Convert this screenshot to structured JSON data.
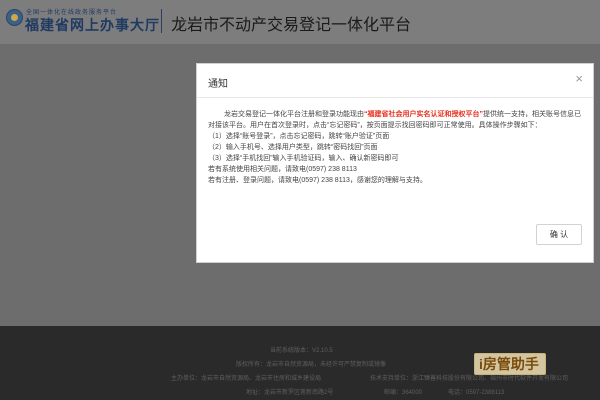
{
  "header": {
    "org_small": "全国一体化在线政务服务平台",
    "org_big": "福建省网上办事大厅",
    "site_title": "龙岩市不动产交易登记一体化平台"
  },
  "modal": {
    "title": "通知",
    "close": "×",
    "intro_before": "龙岩交易登记一体化平台注册和登录功能现由",
    "intro_highlight": "“福建省社会用户实名认证和授权平台”",
    "intro_after": "提供统一支持，相关账号信息已对接该平台。用户在首次登录时，点击“忘记密码”，按页面提示找回密码即可正常使用。具体操作步骤如下：",
    "steps": [
      "（1）选择“账号登录”，点击忘记密码，跳转“账户验证”页面",
      "（2）输入手机号、选择用户类型，跳转“密码找回”页面",
      "（3）选择“手机找回”输入手机验证码，输入、确认新密码即可"
    ],
    "contact_1": "若有系统使用相关问题，请致电(0597) 238 8113",
    "contact_2": "若有注册、登录问题，请致电(0597) 238 8113，感谢您的理解与支持。",
    "confirm_label": "确 认"
  },
  "footer": {
    "version": "当前系统版本：V2.10.5",
    "copyright": "版权所有：龙岩市自然资源局，未经许可严禁复制或镜像",
    "sponsor": "主办单位：龙岩市自然资源局、龙岩市住房和城乡建设局",
    "support": "技术支持单位：浙江臻善科技股份有限公司、福州市时代软件开发有限公司",
    "address": "地址：龙岩市新罗区莲新南路2号",
    "postcode": "邮编：364000",
    "phone": "电话：0597-2388113"
  },
  "watermark": {
    "text": "i房管助手"
  }
}
